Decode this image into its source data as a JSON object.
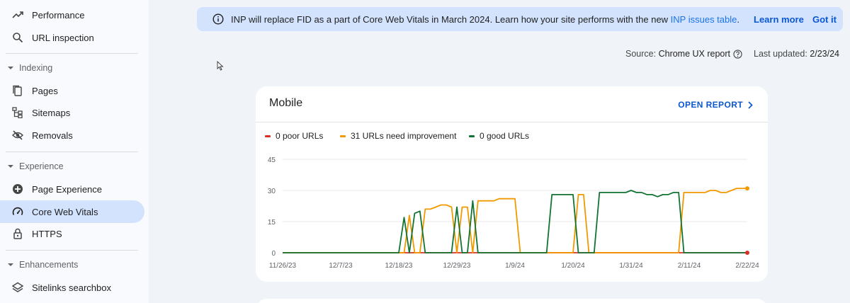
{
  "sidebar": {
    "top_items": [
      {
        "label": "Performance",
        "icon": "trending-up-icon"
      },
      {
        "label": "URL inspection",
        "icon": "search-icon"
      }
    ],
    "sections": [
      {
        "title": "Indexing",
        "items": [
          {
            "label": "Pages",
            "icon": "pages-icon"
          },
          {
            "label": "Sitemaps",
            "icon": "sitemap-icon"
          },
          {
            "label": "Removals",
            "icon": "removals-icon"
          }
        ]
      },
      {
        "title": "Experience",
        "items": [
          {
            "label": "Page Experience",
            "icon": "plus-circle-icon"
          },
          {
            "label": "Core Web Vitals",
            "icon": "speedometer-icon",
            "active": true
          },
          {
            "label": "HTTPS",
            "icon": "lock-icon"
          }
        ]
      },
      {
        "title": "Enhancements",
        "items": [
          {
            "label": "Sitelinks searchbox",
            "icon": "layers-icon"
          }
        ]
      }
    ]
  },
  "banner": {
    "text_before": "INP will replace FID as a part of Core Web Vitals in March 2024. Learn how your site performs with the new ",
    "link_text": "INP issues table",
    "text_after": ".",
    "learn_more": "Learn more",
    "got_it": "Got it"
  },
  "source": {
    "label": "Source:",
    "value": "Chrome UX report",
    "updated_label": "Last updated:",
    "updated_value": "2/23/24"
  },
  "card": {
    "title": "Mobile",
    "open_report": "OPEN REPORT",
    "legend": [
      {
        "label": "0 poor URLs",
        "color": "#d93025"
      },
      {
        "label": "31 URLs need improvement",
        "color": "#f29900"
      },
      {
        "label": "0 good URLs",
        "color": "#137333"
      }
    ]
  },
  "chart_data": {
    "type": "line",
    "x": [
      "11/26/23",
      "11/27/23",
      "11/28/23",
      "11/29/23",
      "11/30/23",
      "12/1/23",
      "12/2/23",
      "12/3/23",
      "12/4/23",
      "12/5/23",
      "12/6/23",
      "12/7/23",
      "12/8/23",
      "12/9/23",
      "12/10/23",
      "12/11/23",
      "12/12/23",
      "12/13/23",
      "12/14/23",
      "12/15/23",
      "12/16/23",
      "12/17/23",
      "12/18/23",
      "12/19/23",
      "12/20/23",
      "12/21/23",
      "12/22/23",
      "12/23/23",
      "12/24/23",
      "12/25/23",
      "12/26/23",
      "12/27/23",
      "12/28/23",
      "12/29/23",
      "12/30/23",
      "12/31/23",
      "1/1/24",
      "1/2/24",
      "1/3/24",
      "1/4/24",
      "1/5/24",
      "1/6/24",
      "1/7/24",
      "1/8/24",
      "1/9/24",
      "1/10/24",
      "1/11/24",
      "1/12/24",
      "1/13/24",
      "1/14/24",
      "1/15/24",
      "1/16/24",
      "1/17/24",
      "1/18/24",
      "1/19/24",
      "1/20/24",
      "1/21/24",
      "1/22/24",
      "1/23/24",
      "1/24/24",
      "1/25/24",
      "1/26/24",
      "1/27/24",
      "1/28/24",
      "1/29/24",
      "1/30/24",
      "1/31/24",
      "2/1/24",
      "2/2/24",
      "2/3/24",
      "2/4/24",
      "2/5/24",
      "2/6/24",
      "2/7/24",
      "2/8/24",
      "2/9/24",
      "2/10/24",
      "2/11/24",
      "2/12/24",
      "2/13/24",
      "2/14/24",
      "2/15/24",
      "2/16/24",
      "2/17/24",
      "2/18/24",
      "2/19/24",
      "2/20/24",
      "2/21/24",
      "2/22/24"
    ],
    "series": [
      {
        "name": "Poor",
        "color": "#d93025",
        "values": [
          0,
          0,
          0,
          0,
          0,
          0,
          0,
          0,
          0,
          0,
          0,
          0,
          0,
          0,
          0,
          0,
          0,
          0,
          0,
          0,
          0,
          0,
          0,
          0,
          0,
          0,
          0,
          0,
          0,
          0,
          0,
          0,
          0,
          0,
          0,
          0,
          0,
          0,
          0,
          0,
          0,
          0,
          0,
          0,
          0,
          0,
          0,
          0,
          0,
          0,
          0,
          0,
          0,
          0,
          0,
          0,
          0,
          0,
          0,
          0,
          0,
          0,
          0,
          0,
          0,
          0,
          0,
          0,
          0,
          0,
          0,
          0,
          0,
          0,
          0,
          0,
          0,
          0,
          0,
          0,
          0,
          0,
          0,
          0,
          0,
          0,
          0,
          0,
          0
        ]
      },
      {
        "name": "Need improvement",
        "color": "#f29900",
        "values": [
          0,
          0,
          0,
          0,
          0,
          0,
          0,
          0,
          0,
          0,
          0,
          0,
          0,
          0,
          0,
          0,
          0,
          0,
          0,
          0,
          0,
          0,
          0,
          0,
          18,
          0,
          0,
          21,
          21,
          22,
          23,
          23,
          22,
          0,
          22,
          22,
          0,
          25,
          25,
          25,
          25,
          26,
          26,
          26,
          26,
          0,
          0,
          0,
          0,
          0,
          0,
          0,
          0,
          0,
          0,
          0,
          28,
          28,
          0,
          0,
          0,
          0,
          0,
          0,
          0,
          0,
          0,
          0,
          0,
          0,
          0,
          0,
          0,
          0,
          0,
          0,
          29,
          29,
          29,
          29,
          29,
          30,
          30,
          29,
          29,
          30,
          31,
          31,
          31
        ]
      },
      {
        "name": "Good",
        "color": "#137333",
        "values": [
          0,
          0,
          0,
          0,
          0,
          0,
          0,
          0,
          0,
          0,
          0,
          0,
          0,
          0,
          0,
          0,
          0,
          0,
          0,
          0,
          0,
          0,
          0,
          17,
          0,
          19,
          20,
          0,
          0,
          0,
          0,
          0,
          0,
          22,
          0,
          0,
          25,
          0,
          0,
          0,
          0,
          0,
          0,
          0,
          0,
          0,
          0,
          0,
          0,
          0,
          0,
          28,
          28,
          28,
          28,
          28,
          0,
          0,
          0,
          0,
          29,
          29,
          29,
          29,
          29,
          29,
          30,
          29,
          29,
          28,
          28,
          27,
          28,
          28,
          29,
          29,
          0,
          0,
          0,
          0,
          0,
          0,
          0,
          0,
          0,
          0,
          0,
          0,
          0
        ]
      }
    ],
    "ylim": [
      0,
      45
    ],
    "yticks": [
      "0",
      "15",
      "30",
      "45"
    ],
    "xticks": [
      "11/26/23",
      "12/7/23",
      "12/18/23",
      "12/29/23",
      "1/9/24",
      "1/20/24",
      "1/31/24",
      "2/11/24",
      "2/22/24"
    ],
    "grid": true,
    "legend": "top"
  }
}
